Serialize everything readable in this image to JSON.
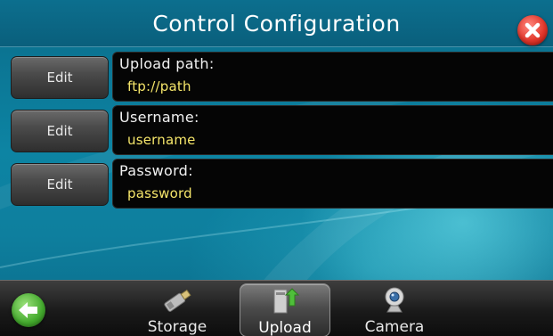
{
  "header": {
    "title": "Control Configuration"
  },
  "fields": [
    {
      "button_label": "Edit",
      "label": "Upload path:",
      "value": "ftp://path"
    },
    {
      "button_label": "Edit",
      "label": "Username:",
      "value": "username"
    },
    {
      "button_label": "Edit",
      "label": "Password:",
      "value": "password"
    }
  ],
  "nav": {
    "tabs": [
      {
        "label": "Storage",
        "icon": "usb-drive-icon"
      },
      {
        "label": "Upload",
        "icon": "upload-icon",
        "active": true
      },
      {
        "label": "Camera",
        "icon": "webcam-icon"
      }
    ]
  },
  "colors": {
    "value_text": "#f5e56a",
    "close_button": "#e2382c",
    "back_button": "#43a92d"
  }
}
